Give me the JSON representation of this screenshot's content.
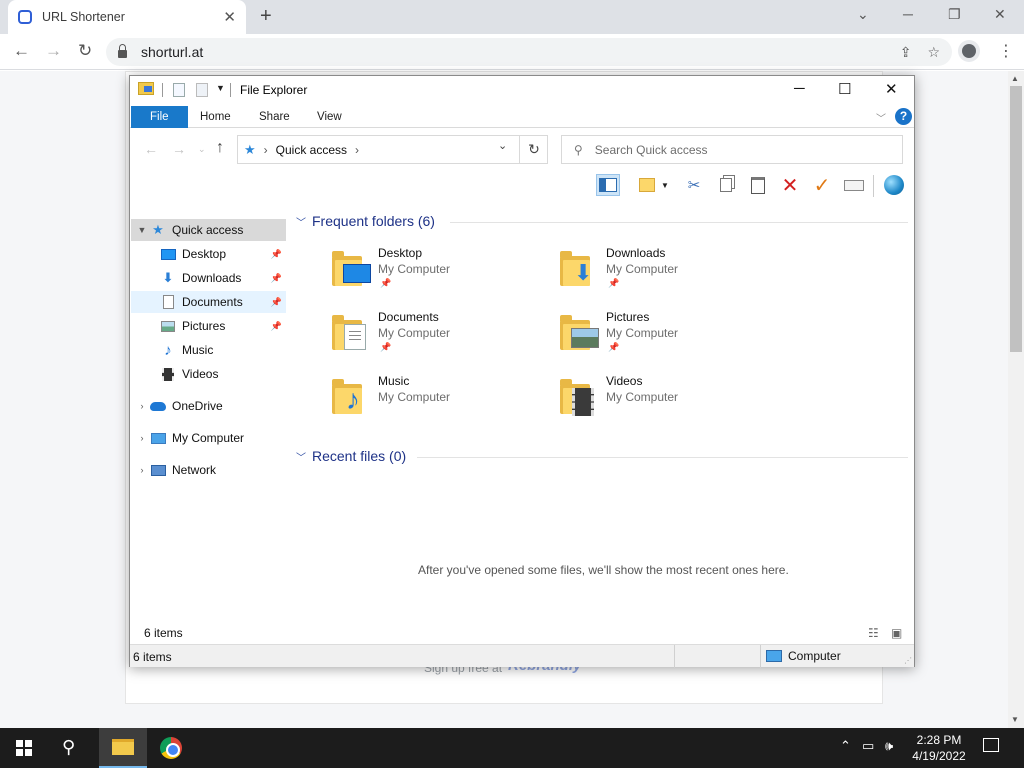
{
  "browser": {
    "tab_title": "URL Shortener",
    "url": "shorturl.at",
    "page_footer_text": "Sign up free at",
    "page_footer_brand": "Rebrandly"
  },
  "explorer": {
    "title": "File Explorer",
    "ribbon_tabs": [
      "File",
      "Home",
      "Share",
      "View"
    ],
    "address": {
      "location": "Quick access"
    },
    "search_placeholder": "Search Quick access",
    "nav": [
      {
        "label": "Quick access",
        "icon": "star-icon",
        "expandable": true,
        "expanded": true
      },
      {
        "label": "Desktop",
        "icon": "desktop-icon",
        "pinned": true
      },
      {
        "label": "Downloads",
        "icon": "download-icon",
        "pinned": true
      },
      {
        "label": "Documents",
        "icon": "document-icon",
        "pinned": true
      },
      {
        "label": "Pictures",
        "icon": "picture-icon",
        "pinned": true
      },
      {
        "label": "Music",
        "icon": "music-icon",
        "pinned": false
      },
      {
        "label": "Videos",
        "icon": "video-icon",
        "pinned": false
      },
      {
        "label": "OneDrive",
        "icon": "cloud-icon",
        "expandable": true
      },
      {
        "label": "My Computer",
        "icon": "computer-icon",
        "expandable": true
      },
      {
        "label": "Network",
        "icon": "network-icon",
        "expandable": true
      }
    ],
    "frequent_header": "Frequent folders (6)",
    "folders": [
      {
        "name": "Desktop",
        "location": "My Computer",
        "pinned": true
      },
      {
        "name": "Downloads",
        "location": "My Computer",
        "pinned": true
      },
      {
        "name": "Documents",
        "location": "My Computer",
        "pinned": true
      },
      {
        "name": "Pictures",
        "location": "My Computer",
        "pinned": true
      },
      {
        "name": "Music",
        "location": "My Computer",
        "pinned": false
      },
      {
        "name": "Videos",
        "location": "My Computer",
        "pinned": false
      }
    ],
    "recent_header": "Recent files (0)",
    "recent_empty_message": "After you've opened some files, we'll show the most recent ones here.",
    "items_count": "6 items",
    "status_items": "6 items",
    "status_location": "Computer"
  },
  "taskbar": {
    "time": "2:28 PM",
    "date": "4/19/2022"
  }
}
